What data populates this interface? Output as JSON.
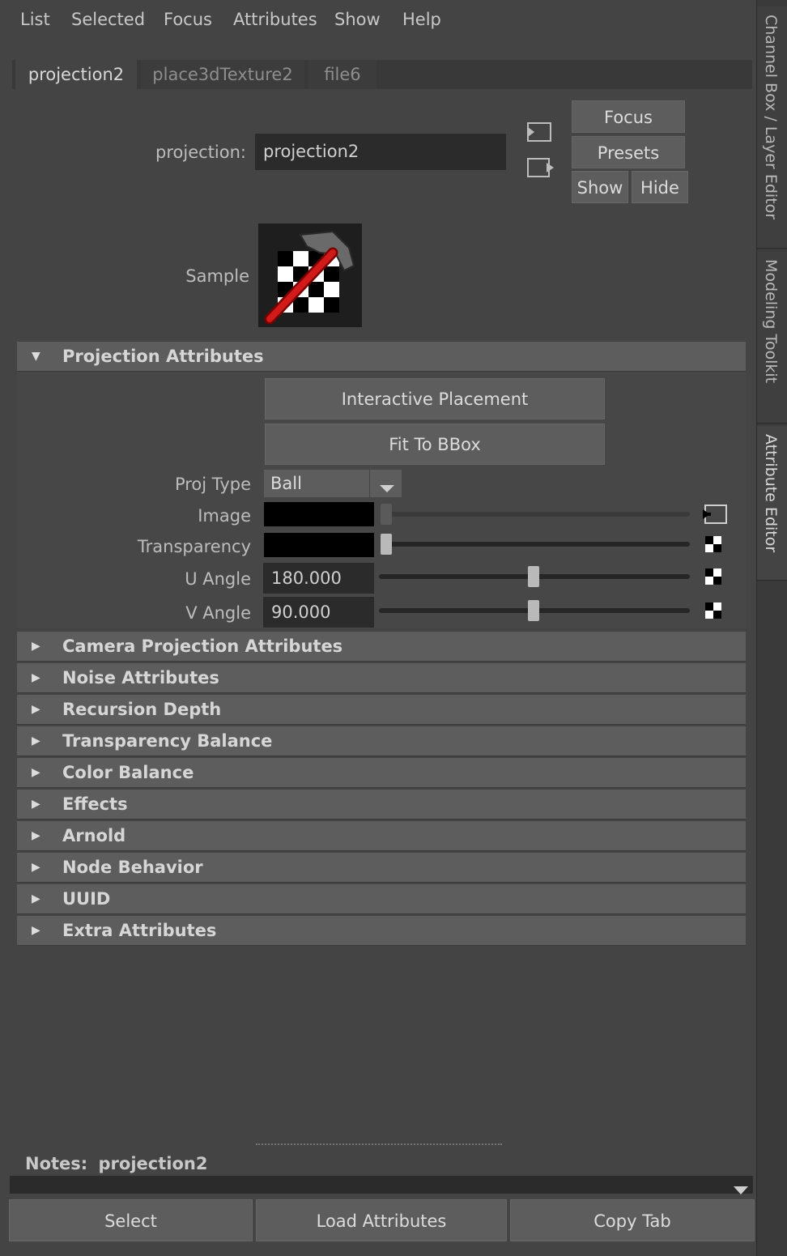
{
  "menu": [
    "List",
    "Selected",
    "Focus",
    "Attributes",
    "Show",
    "Help"
  ],
  "side_tabs": [
    "Channel Box / Layer Editor",
    "Modeling Toolkit",
    "Attribute Editor"
  ],
  "tabs": [
    "projection2",
    "place3dTexture2",
    "file6"
  ],
  "node": {
    "label": "projection:",
    "value": "projection2",
    "sample_label": "Sample"
  },
  "buttons": {
    "focus": "Focus",
    "presets": "Presets",
    "show": "Show",
    "hide": "Hide"
  },
  "projection_section": {
    "title": "Projection Attributes",
    "interactive_placement": "Interactive Placement",
    "fit_to_bbox": "Fit To BBox",
    "proj_type_label": "Proj Type",
    "proj_type_value": "Ball",
    "image_label": "Image",
    "transparency_label": "Transparency",
    "u_angle_label": "U Angle",
    "u_angle_value": "180.000",
    "v_angle_label": "V Angle",
    "v_angle_value": "90.000",
    "u_angle_slider": 0.5,
    "v_angle_slider": 0.5,
    "image_slider": 0.0,
    "transparency_slider": 0.0
  },
  "collapsed_sections": [
    "Camera Projection Attributes",
    "Noise Attributes",
    "Recursion Depth",
    "Transparency Balance",
    "Color Balance",
    "Effects",
    "Arnold",
    "Node Behavior",
    "UUID",
    "Extra Attributes"
  ],
  "notes": {
    "label": "Notes:",
    "node": "projection2"
  },
  "bottom_buttons": {
    "select": "Select",
    "load_attributes": "Load Attributes",
    "copy_tab": "Copy Tab"
  },
  "colors": {
    "background": "#444444",
    "section_header": "#5d5d5d",
    "field": "#2b2b2b",
    "swatch": "#000000"
  }
}
